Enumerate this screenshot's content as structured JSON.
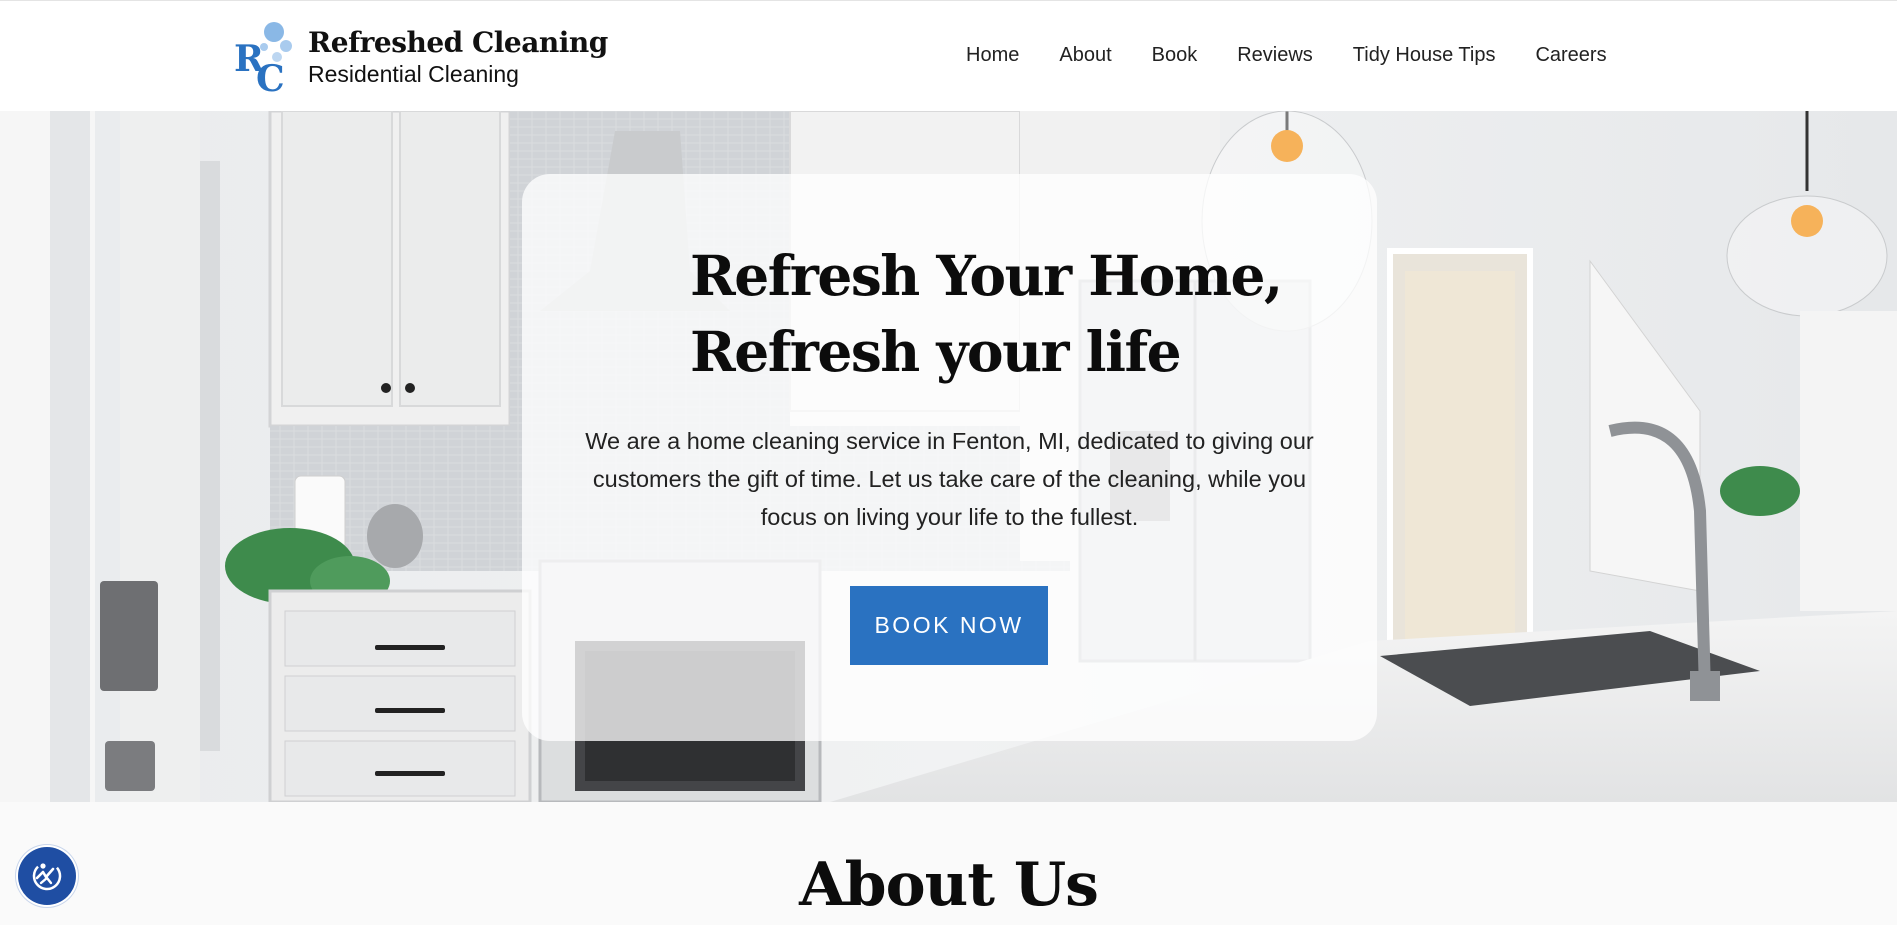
{
  "brand": {
    "name": "Refreshed Cleaning",
    "subtitle": "Residential Cleaning",
    "logo_letters": "RC",
    "logo_color": "#2a72c1"
  },
  "nav": {
    "items": [
      {
        "label": "Home"
      },
      {
        "label": "About"
      },
      {
        "label": "Book"
      },
      {
        "label": "Reviews"
      },
      {
        "label": "Tidy House Tips"
      },
      {
        "label": "Careers"
      }
    ]
  },
  "hero": {
    "title_line1": "Refresh Your Home,",
    "title_line2": "Refresh your life",
    "description": "We are a home cleaning service in Fenton, MI, dedicated to giving our customers the gift of time. Let us take care of the cleaning, while you focus on living your life to the fullest.",
    "cta_label": "BOOK NOW",
    "cta_color": "#2a72c1"
  },
  "about": {
    "title": "About Us"
  },
  "accessibility": {
    "icon": "accessibility-icon",
    "color": "#1f4ea3"
  }
}
